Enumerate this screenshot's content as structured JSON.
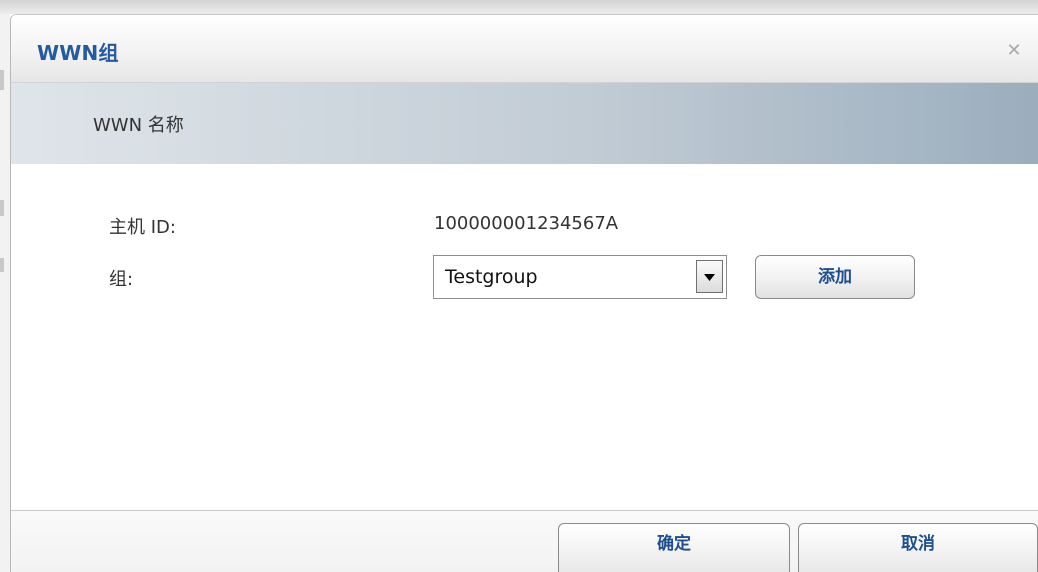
{
  "dialog": {
    "title": "WWN组",
    "close_icon": "close-icon",
    "section_title": "WWN 名称"
  },
  "form": {
    "host_id_label": "主机 ID:",
    "host_id_value": "100000001234567A",
    "group_label": "组:",
    "group_selected": "Testgroup",
    "add_label": "添加"
  },
  "footer": {
    "confirm_label": "确定",
    "cancel_label": "取消"
  },
  "colors": {
    "title": "#245aa0",
    "button_text": "#1f4f8f",
    "header_gradient_end": "#9aadbd"
  }
}
